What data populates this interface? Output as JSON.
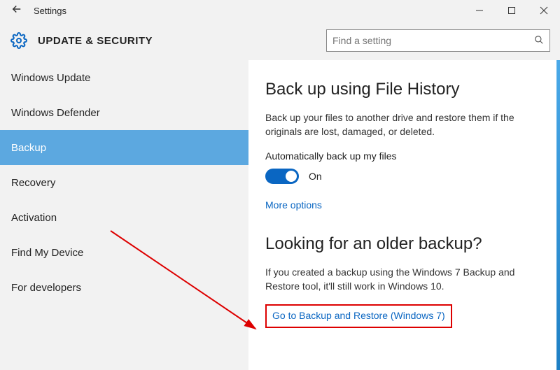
{
  "window": {
    "title": "Settings"
  },
  "header": {
    "section": "UPDATE & SECURITY",
    "search_placeholder": "Find a setting"
  },
  "sidebar": {
    "items": [
      {
        "label": "Windows Update",
        "active": false
      },
      {
        "label": "Windows Defender",
        "active": false
      },
      {
        "label": "Backup",
        "active": true
      },
      {
        "label": "Recovery",
        "active": false
      },
      {
        "label": "Activation",
        "active": false
      },
      {
        "label": "Find My Device",
        "active": false
      },
      {
        "label": "For developers",
        "active": false
      }
    ]
  },
  "main": {
    "h1": "Back up using File History",
    "p1": "Back up your files to another drive and restore them if the originals are lost, damaged, or deleted.",
    "toggle_caption": "Automatically back up my files",
    "toggle_state": "On",
    "more_options": "More options",
    "h2": "Looking for an older backup?",
    "p2": "If you created a backup using the Windows 7 Backup and Restore tool, it'll still work in Windows 10.",
    "link2": "Go to Backup and Restore (Windows 7)"
  }
}
